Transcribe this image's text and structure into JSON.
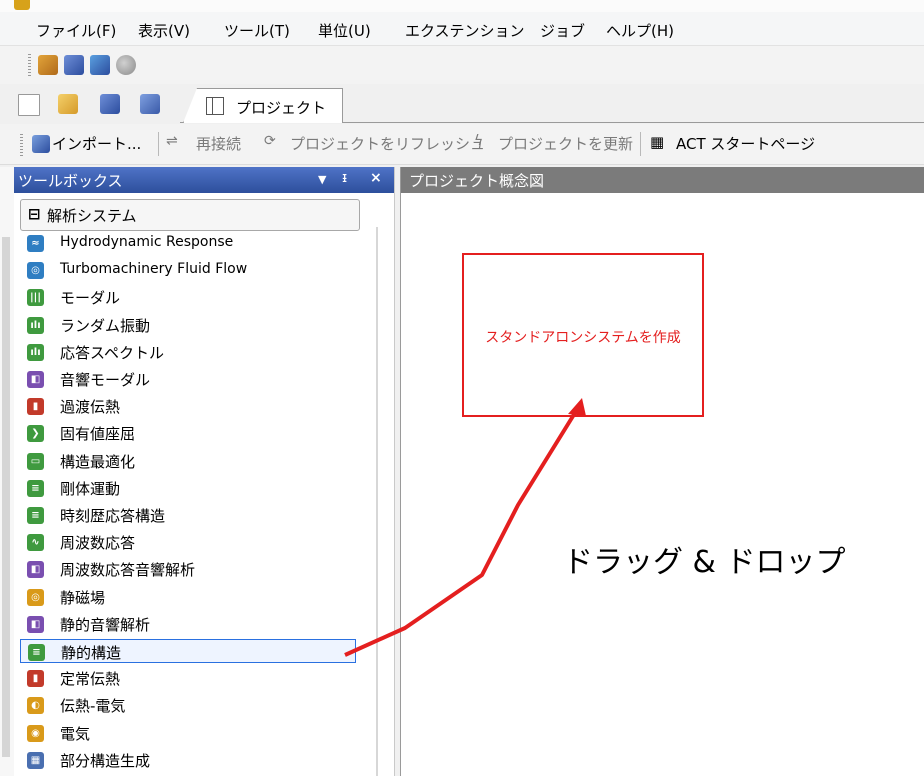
{
  "menubar": {
    "items": [
      "ファイル(F)",
      "表示(V)",
      "ツール(T)",
      "単位(U)",
      "エクステンション",
      "ジョブ",
      "ヘルプ(H)"
    ]
  },
  "tabs": {
    "project": "プロジェクト"
  },
  "toolbar2": {
    "import": "インポート...",
    "reconnect": "再接続",
    "refresh": "プロジェクトをリフレッシュ",
    "update": "プロジェクトを更新",
    "act_start": "ACT スタートページ"
  },
  "toolbox": {
    "title": "ツールボックス",
    "pin_icon": "pin-icon",
    "category": "解析システム",
    "items": [
      {
        "label": "Hydrodynamic Response",
        "icon": "hydrodynamic-response-icon",
        "color": "#2f7ec2",
        "glyph": "≈"
      },
      {
        "label": "Turbomachinery Fluid Flow",
        "icon": "turbomachinery-icon",
        "color": "#2f7ec2",
        "glyph": "◎"
      },
      {
        "label": "モーダル",
        "icon": "modal-icon",
        "color": "#3f9a3f",
        "glyph": "|||"
      },
      {
        "label": "ランダム振動",
        "icon": "random-vibration-icon",
        "color": "#3f9a3f",
        "glyph": "ılı"
      },
      {
        "label": "応答スペクトル",
        "icon": "response-spectrum-icon",
        "color": "#3f9a3f",
        "glyph": "ılı"
      },
      {
        "label": "音響モーダル",
        "icon": "acoustic-modal-icon",
        "color": "#7a4fb0",
        "glyph": "◧"
      },
      {
        "label": "過渡伝熱",
        "icon": "transient-thermal-icon",
        "color": "#c23a2a",
        "glyph": "▮"
      },
      {
        "label": "固有値座屈",
        "icon": "eigenvalue-buckling-icon",
        "color": "#3f9a3f",
        "glyph": "❯"
      },
      {
        "label": "構造最適化",
        "icon": "topology-optimization-icon",
        "color": "#3f9a3f",
        "glyph": "▭"
      },
      {
        "label": "剛体運動",
        "icon": "rigid-dynamics-icon",
        "color": "#3f9a3f",
        "glyph": "≡"
      },
      {
        "label": "時刻歴応答構造",
        "icon": "transient-structural-icon",
        "color": "#3f9a3f",
        "glyph": "≡"
      },
      {
        "label": "周波数応答",
        "icon": "harmonic-response-icon",
        "color": "#3f9a3f",
        "glyph": "∿"
      },
      {
        "label": "周波数応答音響解析",
        "icon": "harmonic-acoustics-icon",
        "color": "#7a4fb0",
        "glyph": "◧"
      },
      {
        "label": "静磁場",
        "icon": "magnetostatic-icon",
        "color": "#d99a1a",
        "glyph": "◎"
      },
      {
        "label": "静的音響解析",
        "icon": "static-acoustics-icon",
        "color": "#7a4fb0",
        "glyph": "◧"
      },
      {
        "label": "静的構造",
        "icon": "static-structural-icon",
        "color": "#3f9a3f",
        "glyph": "≡"
      },
      {
        "label": "定常伝熱",
        "icon": "steady-thermal-icon",
        "color": "#c23a2a",
        "glyph": "▮"
      },
      {
        "label": "伝熱-電気",
        "icon": "thermal-electric-icon",
        "color": "#d99a1a",
        "glyph": "◐"
      },
      {
        "label": "電気",
        "icon": "electric-icon",
        "color": "#d99a1a",
        "glyph": "◉"
      },
      {
        "label": "部分構造生成",
        "icon": "substructure-generation-icon",
        "color": "#4a6fb0",
        "glyph": "▦"
      }
    ],
    "selected_index": 15
  },
  "schematic": {
    "title": "プロジェクト概念図",
    "drop_box_text": "スタンドアロンシステムを作成",
    "annotation": "ドラッグ & ドロップ",
    "annotation_color": "#e41f1f"
  }
}
